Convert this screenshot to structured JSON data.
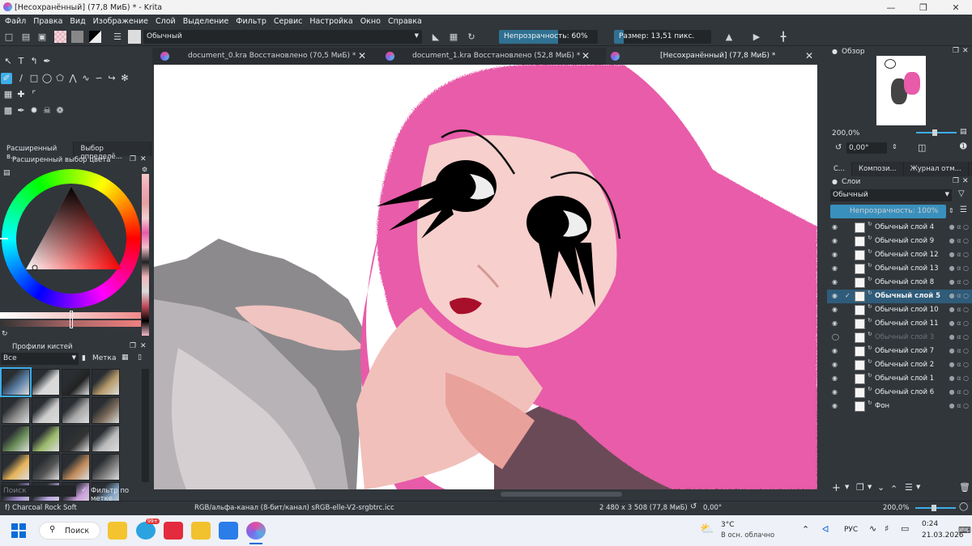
{
  "window": {
    "title": "[Несохранённый]  (77,8 МиБ) * - Krita"
  },
  "menu": [
    "Файл",
    "Правка",
    "Вид",
    "Изображение",
    "Слой",
    "Выделение",
    "Фильтр",
    "Сервис",
    "Настройка",
    "Окно",
    "Справка"
  ],
  "toolbar": {
    "blend_mode": "Обычный",
    "opacity_label": "Непрозрачность: 60%",
    "opacity_value": 0.6,
    "size_label": "Размер: 13,51 пикс."
  },
  "left": {
    "tabs": [
      "Расширенный в...",
      "Выбор определё..."
    ],
    "color_panel_title": "Расширенный выбор цвета",
    "brush_panel_title": "Профили кистей",
    "brush_filter": "Все",
    "brush_tag": "Метка",
    "brush_search_placeholder": "Поиск",
    "filter_by_tag": "Фильтр по метке"
  },
  "tabs": [
    {
      "label": "document_0.kra Восстановлено (70,5 МиБ) *"
    },
    {
      "label": "document_1.kra Восстановлено (52,8 МиБ) *"
    },
    {
      "label": "[Несохранённый]  (77,8 МиБ) *"
    }
  ],
  "overview": {
    "title": "Обзор",
    "zoom": "200,0%",
    "rotation": "0,00°"
  },
  "right_tabs": [
    "С...",
    "Компози...",
    "Журнал отм..."
  ],
  "layers": {
    "title": "Слои",
    "blend_mode": "Обычный",
    "opacity_label": "Непрозрачность:  100%",
    "items": [
      {
        "name": "Обычный слой 4"
      },
      {
        "name": "Обычный слой 9"
      },
      {
        "name": "Обычный слой 12"
      },
      {
        "name": "Обычный слой 13"
      },
      {
        "name": "Обычный слой 8"
      },
      {
        "name": "Обычный слой 5",
        "selected": true
      },
      {
        "name": "Обычный слой 10"
      },
      {
        "name": "Обычный слой 11"
      },
      {
        "name": "Обычный слой 3",
        "hidden": true
      },
      {
        "name": "Обычный слой 7"
      },
      {
        "name": "Обычный слой 2"
      },
      {
        "name": "Обычный слой 1"
      },
      {
        "name": "Обычный слой 6"
      },
      {
        "name": "Фон"
      }
    ]
  },
  "status": {
    "brush": "f) Charcoal Rock Soft",
    "color_space": "RGB/альфа-канал (8-бит/канал)  sRGB-elle-V2-srgbtrc.icc",
    "dimensions": "2 480 x 3 508 (77,8 МиБ)",
    "rotation": "0,00°",
    "zoom": "200,0%"
  },
  "taskbar": {
    "search": "Поиск",
    "weather_temp": "3°C",
    "weather_desc": "В осн. облачно",
    "lang": "РУС",
    "time": "0:24",
    "date": "21.03.2026",
    "badge": "99+"
  },
  "colors": {
    "accent": "#3daee9",
    "panel": "#31363b",
    "pink": "#e85ba9"
  }
}
